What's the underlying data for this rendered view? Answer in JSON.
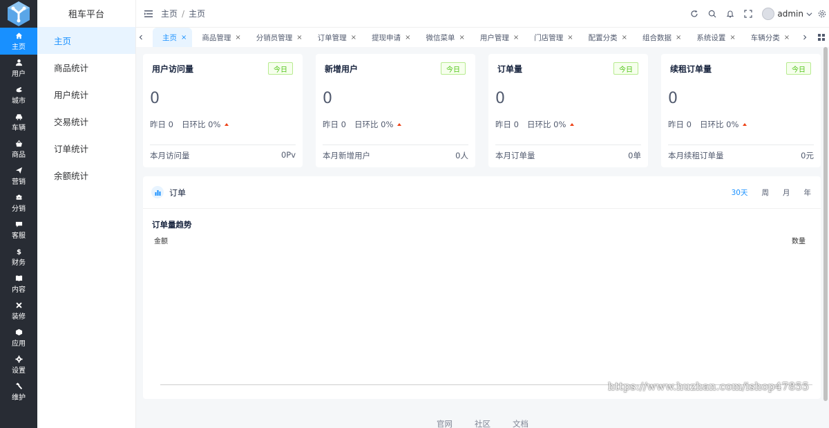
{
  "rail": {
    "items": [
      {
        "label": "主页",
        "icon": "home-icon",
        "active": true
      },
      {
        "label": "用户",
        "icon": "user-icon"
      },
      {
        "label": "城市",
        "icon": "city-icon"
      },
      {
        "label": "车辆",
        "icon": "car-icon"
      },
      {
        "label": "商品",
        "icon": "goods-icon"
      },
      {
        "label": "营销",
        "icon": "send-icon"
      },
      {
        "label": "分销",
        "icon": "group-icon"
      },
      {
        "label": "客服",
        "icon": "chat-icon"
      },
      {
        "label": "财务",
        "icon": "dollar-icon"
      },
      {
        "label": "内容",
        "icon": "book-icon"
      },
      {
        "label": "装修",
        "icon": "tools-icon"
      },
      {
        "label": "应用",
        "icon": "cube-icon"
      },
      {
        "label": "设置",
        "icon": "gear-icon"
      },
      {
        "label": "维护",
        "icon": "hammer-icon"
      }
    ],
    "accent": "#1890ff",
    "background": "#282c34"
  },
  "submenu": {
    "brand": "租车平台",
    "items": [
      "主页",
      "商品统计",
      "用户统计",
      "交易统计",
      "订单统计",
      "余额统计"
    ]
  },
  "header": {
    "breadcrumb": [
      "主页",
      "主页"
    ],
    "breadcrumb_sep": "/",
    "username": "admin"
  },
  "tabs": [
    {
      "label": "主页",
      "active": true
    },
    {
      "label": "商品管理"
    },
    {
      "label": "分销员管理"
    },
    {
      "label": "订单管理"
    },
    {
      "label": "提现申请"
    },
    {
      "label": "微信菜单"
    },
    {
      "label": "用户管理"
    },
    {
      "label": "门店管理"
    },
    {
      "label": "配置分类"
    },
    {
      "label": "组合数据"
    },
    {
      "label": "系统设置"
    },
    {
      "label": "车辆分类"
    }
  ],
  "tab_close": "×",
  "cards": [
    {
      "title": "用户访问量",
      "tag": "今日",
      "value": "0",
      "yesterday": "昨日 0",
      "ratio": "日环比 0%",
      "foot_label": "本月访问量",
      "foot_value": "0Pv"
    },
    {
      "title": "新增用户",
      "tag": "今日",
      "value": "0",
      "yesterday": "昨日 0",
      "ratio": "日环比 0%",
      "foot_label": "本月新增用户",
      "foot_value": "0人"
    },
    {
      "title": "订单量",
      "tag": "今日",
      "value": "0",
      "yesterday": "昨日 0",
      "ratio": "日环比 0%",
      "foot_label": "本月订单量",
      "foot_value": "0单"
    },
    {
      "title": "续租订单量",
      "tag": "今日",
      "value": "0",
      "yesterday": "昨日 0",
      "ratio": "日环比 0%",
      "foot_label": "本月续租订单量",
      "foot_value": "0元"
    }
  ],
  "order_panel": {
    "title": "订单",
    "ranges": [
      "30天",
      "周",
      "月",
      "年"
    ],
    "active_range": "30天",
    "chart_title": "订单量趋势",
    "y_left_label": "金额",
    "y_right_label": "数量"
  },
  "watermark": "https://www.huzhan.com/ishop47855",
  "footer": [
    "官网",
    "社区",
    "文档"
  ]
}
